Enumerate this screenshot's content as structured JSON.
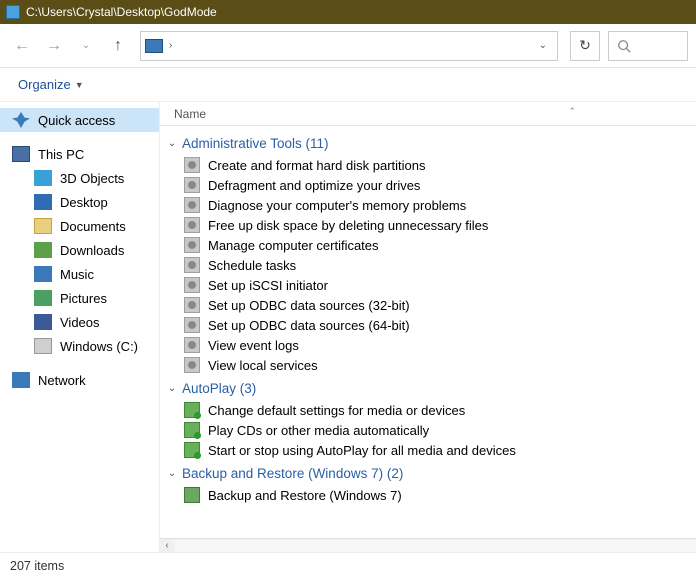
{
  "titlebar": {
    "path": "C:\\Users\\Crystal\\Desktop\\GodMode"
  },
  "toolbar": {
    "organize": "Organize"
  },
  "columns": {
    "name": "Name"
  },
  "nav": {
    "quick": "Quick access",
    "thispc": "This PC",
    "d3d": "3D Objects",
    "desktop": "Desktop",
    "documents": "Documents",
    "downloads": "Downloads",
    "music": "Music",
    "pictures": "Pictures",
    "videos": "Videos",
    "cdrive": "Windows (C:)",
    "network": "Network"
  },
  "groups": [
    {
      "name": "Administrative Tools",
      "count": 11,
      "iconClass": "gear",
      "items": [
        "Create and format hard disk partitions",
        "Defragment and optimize your drives",
        "Diagnose your computer's memory problems",
        "Free up disk space by deleting unnecessary files",
        "Manage computer certificates",
        "Schedule tasks",
        "Set up iSCSI initiator",
        "Set up ODBC data sources (32-bit)",
        "Set up ODBC data sources (64-bit)",
        "View event logs",
        "View local services"
      ]
    },
    {
      "name": "AutoPlay",
      "count": 3,
      "iconClass": "play",
      "items": [
        "Change default settings for media or devices",
        "Play CDs or other media automatically",
        "Start or stop using AutoPlay for all media and devices"
      ]
    },
    {
      "name": "Backup and Restore (Windows 7)",
      "count": 2,
      "iconClass": "bk",
      "items": [
        "Backup and Restore (Windows 7)"
      ]
    }
  ],
  "status": {
    "count": "207 items"
  }
}
